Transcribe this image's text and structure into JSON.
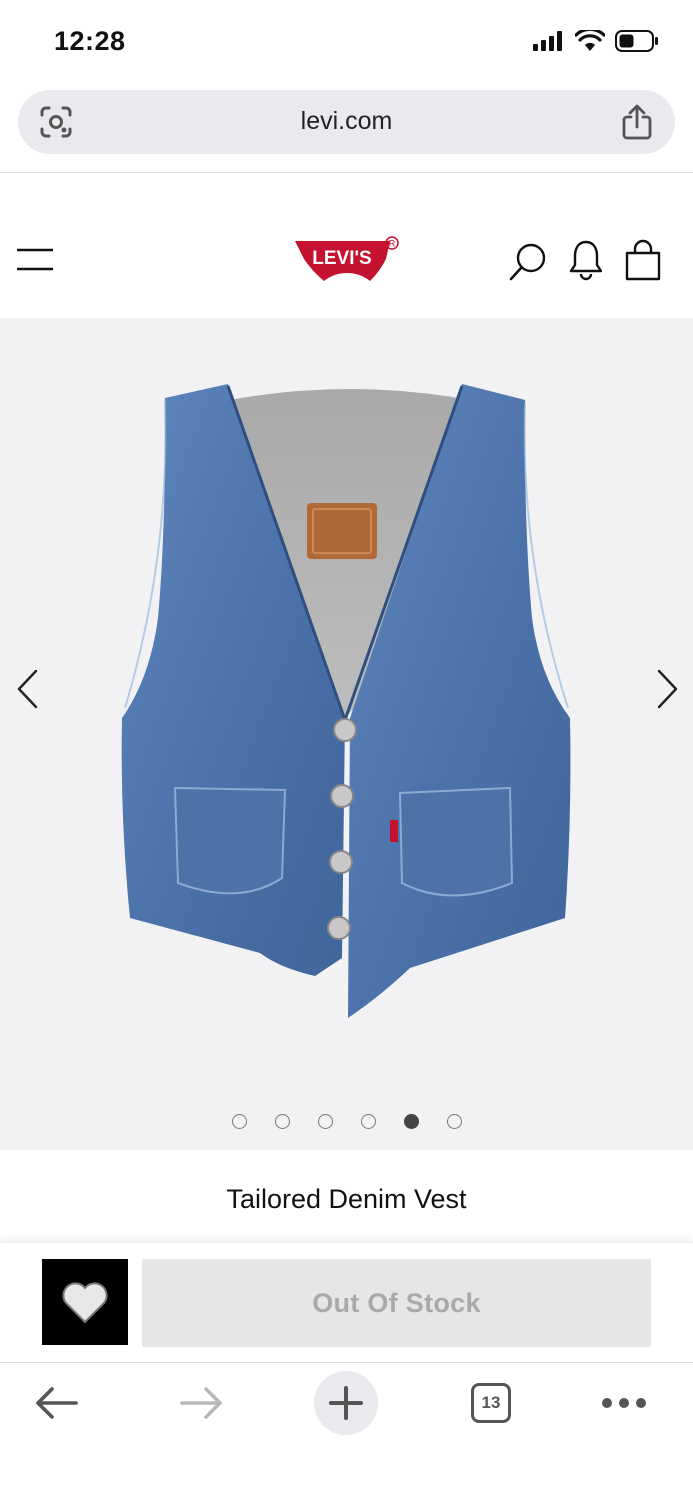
{
  "status_bar": {
    "time": "12:28"
  },
  "url_bar": {
    "url": "levi.com"
  },
  "header": {
    "logo_text": "LEVI'S"
  },
  "gallery": {
    "image_count": 6,
    "active_index": 4,
    "image_icon": "denim-vest-image"
  },
  "product": {
    "title": "Tailored Denim Vest",
    "stock_label": "Out Of Stock"
  },
  "browser_toolbar": {
    "tab_count": "13"
  },
  "colors": {
    "brand_red": "#c41230",
    "gallery_bg": "#f2f2f4",
    "wishlist_bg": "#000000",
    "disabled_button_bg": "#e6e6e6",
    "disabled_button_text": "#a9a9a9"
  }
}
